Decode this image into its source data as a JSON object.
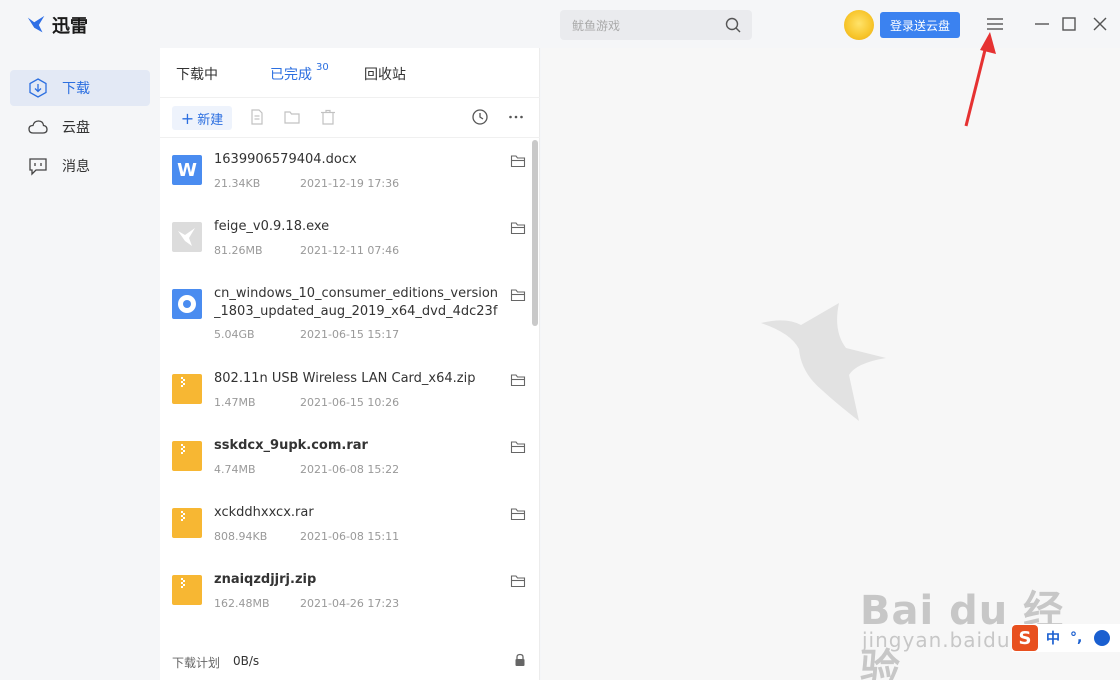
{
  "app": {
    "name": "迅雷"
  },
  "search": {
    "placeholder": "鱿鱼游戏"
  },
  "header": {
    "login_button": "登录送云盘"
  },
  "sidebar": {
    "items": [
      {
        "label": "下载",
        "icon": "download-icon",
        "active": true
      },
      {
        "label": "云盘",
        "icon": "cloud-icon",
        "active": false
      },
      {
        "label": "消息",
        "icon": "message-icon",
        "active": false
      }
    ]
  },
  "tabs": [
    {
      "label": "下载中"
    },
    {
      "label": "已完成",
      "badge": "30",
      "active": true
    },
    {
      "label": "回收站"
    }
  ],
  "toolbar": {
    "new_label": "新建"
  },
  "files": [
    {
      "name": "1639906579404.docx",
      "size": "21.34KB",
      "date": "2021-12-19 17:36",
      "type": "word",
      "bold": false
    },
    {
      "name": "feige_v0.9.18.exe",
      "size": "81.26MB",
      "date": "2021-12-11 07:46",
      "type": "exe",
      "bold": false
    },
    {
      "name": "cn_windows_10_consumer_editions_version_1803_updated_aug_2019_x64_dvd_4dc23fa...",
      "size": "5.04GB",
      "date": "2021-06-15 15:17",
      "type": "disc",
      "bold": false
    },
    {
      "name": "802.11n USB Wireless LAN Card_x64.zip",
      "size": "1.47MB",
      "date": "2021-06-15 10:26",
      "type": "zip",
      "bold": false
    },
    {
      "name": "sskdcx_9upk.com.rar",
      "size": "4.74MB",
      "date": "2021-06-08 15:22",
      "type": "zip",
      "bold": true
    },
    {
      "name": "xckddhxxcx.rar",
      "size": "808.94KB",
      "date": "2021-06-08 15:11",
      "type": "zip",
      "bold": false
    },
    {
      "name": "znaiqzdjjrj.zip",
      "size": "162.48MB",
      "date": "2021-04-26 17:23",
      "type": "zip",
      "bold": true
    }
  ],
  "footer": {
    "label": "下载计划",
    "speed": "0B/s"
  },
  "watermark": {
    "big": "Bai du 经验",
    "small": "jingyan.baidu.com"
  },
  "ime": {
    "logo": "S",
    "mode": "中",
    "punct": "°,"
  },
  "colors": {
    "accent": "#2c6fe0",
    "button": "#3b82f0",
    "zip": "#f7b733",
    "word": "#4a8cf0",
    "arrow": "#e63232"
  }
}
